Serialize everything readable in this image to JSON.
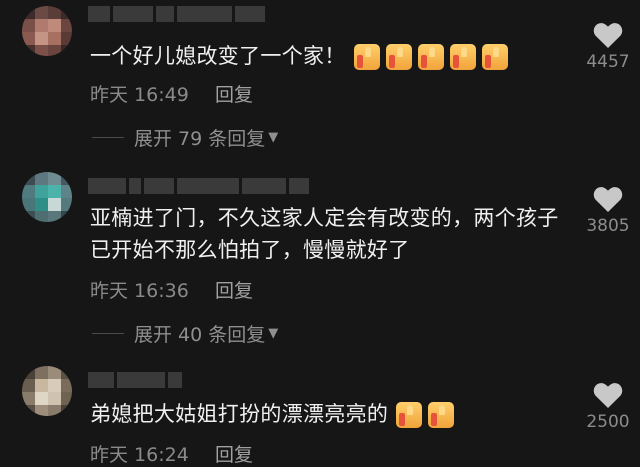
{
  "comments": [
    {
      "text": "一个好儿媳改变了一个家！",
      "thumbs": 5,
      "time": "昨天 16:49",
      "reply_label": "回复",
      "expand_label": "展开 79 条回复",
      "likes": "4457"
    },
    {
      "text": "亚楠进了门，不久这家人定会有改变的，两个孩子已开始不那么怕拍了，慢慢就好了",
      "thumbs": 0,
      "time": "昨天 16:36",
      "reply_label": "回复",
      "expand_label": "展开 40 条回复",
      "likes": "3805"
    },
    {
      "text": "弟媳把大姑姐打扮的漂漂亮亮的",
      "thumbs": 2,
      "time": "昨天 16:24",
      "reply_label": "回复",
      "likes": "2500"
    }
  ],
  "icons": {
    "like": "heart-icon",
    "emoji": "thumbs-up-icon",
    "expand": "triangle-down-icon"
  },
  "colors": {
    "background": "#161616",
    "text": "#f0f0f0",
    "muted": "#8a8a8a",
    "heart": "#c8c8c8",
    "thumb": "#f2a33a"
  }
}
